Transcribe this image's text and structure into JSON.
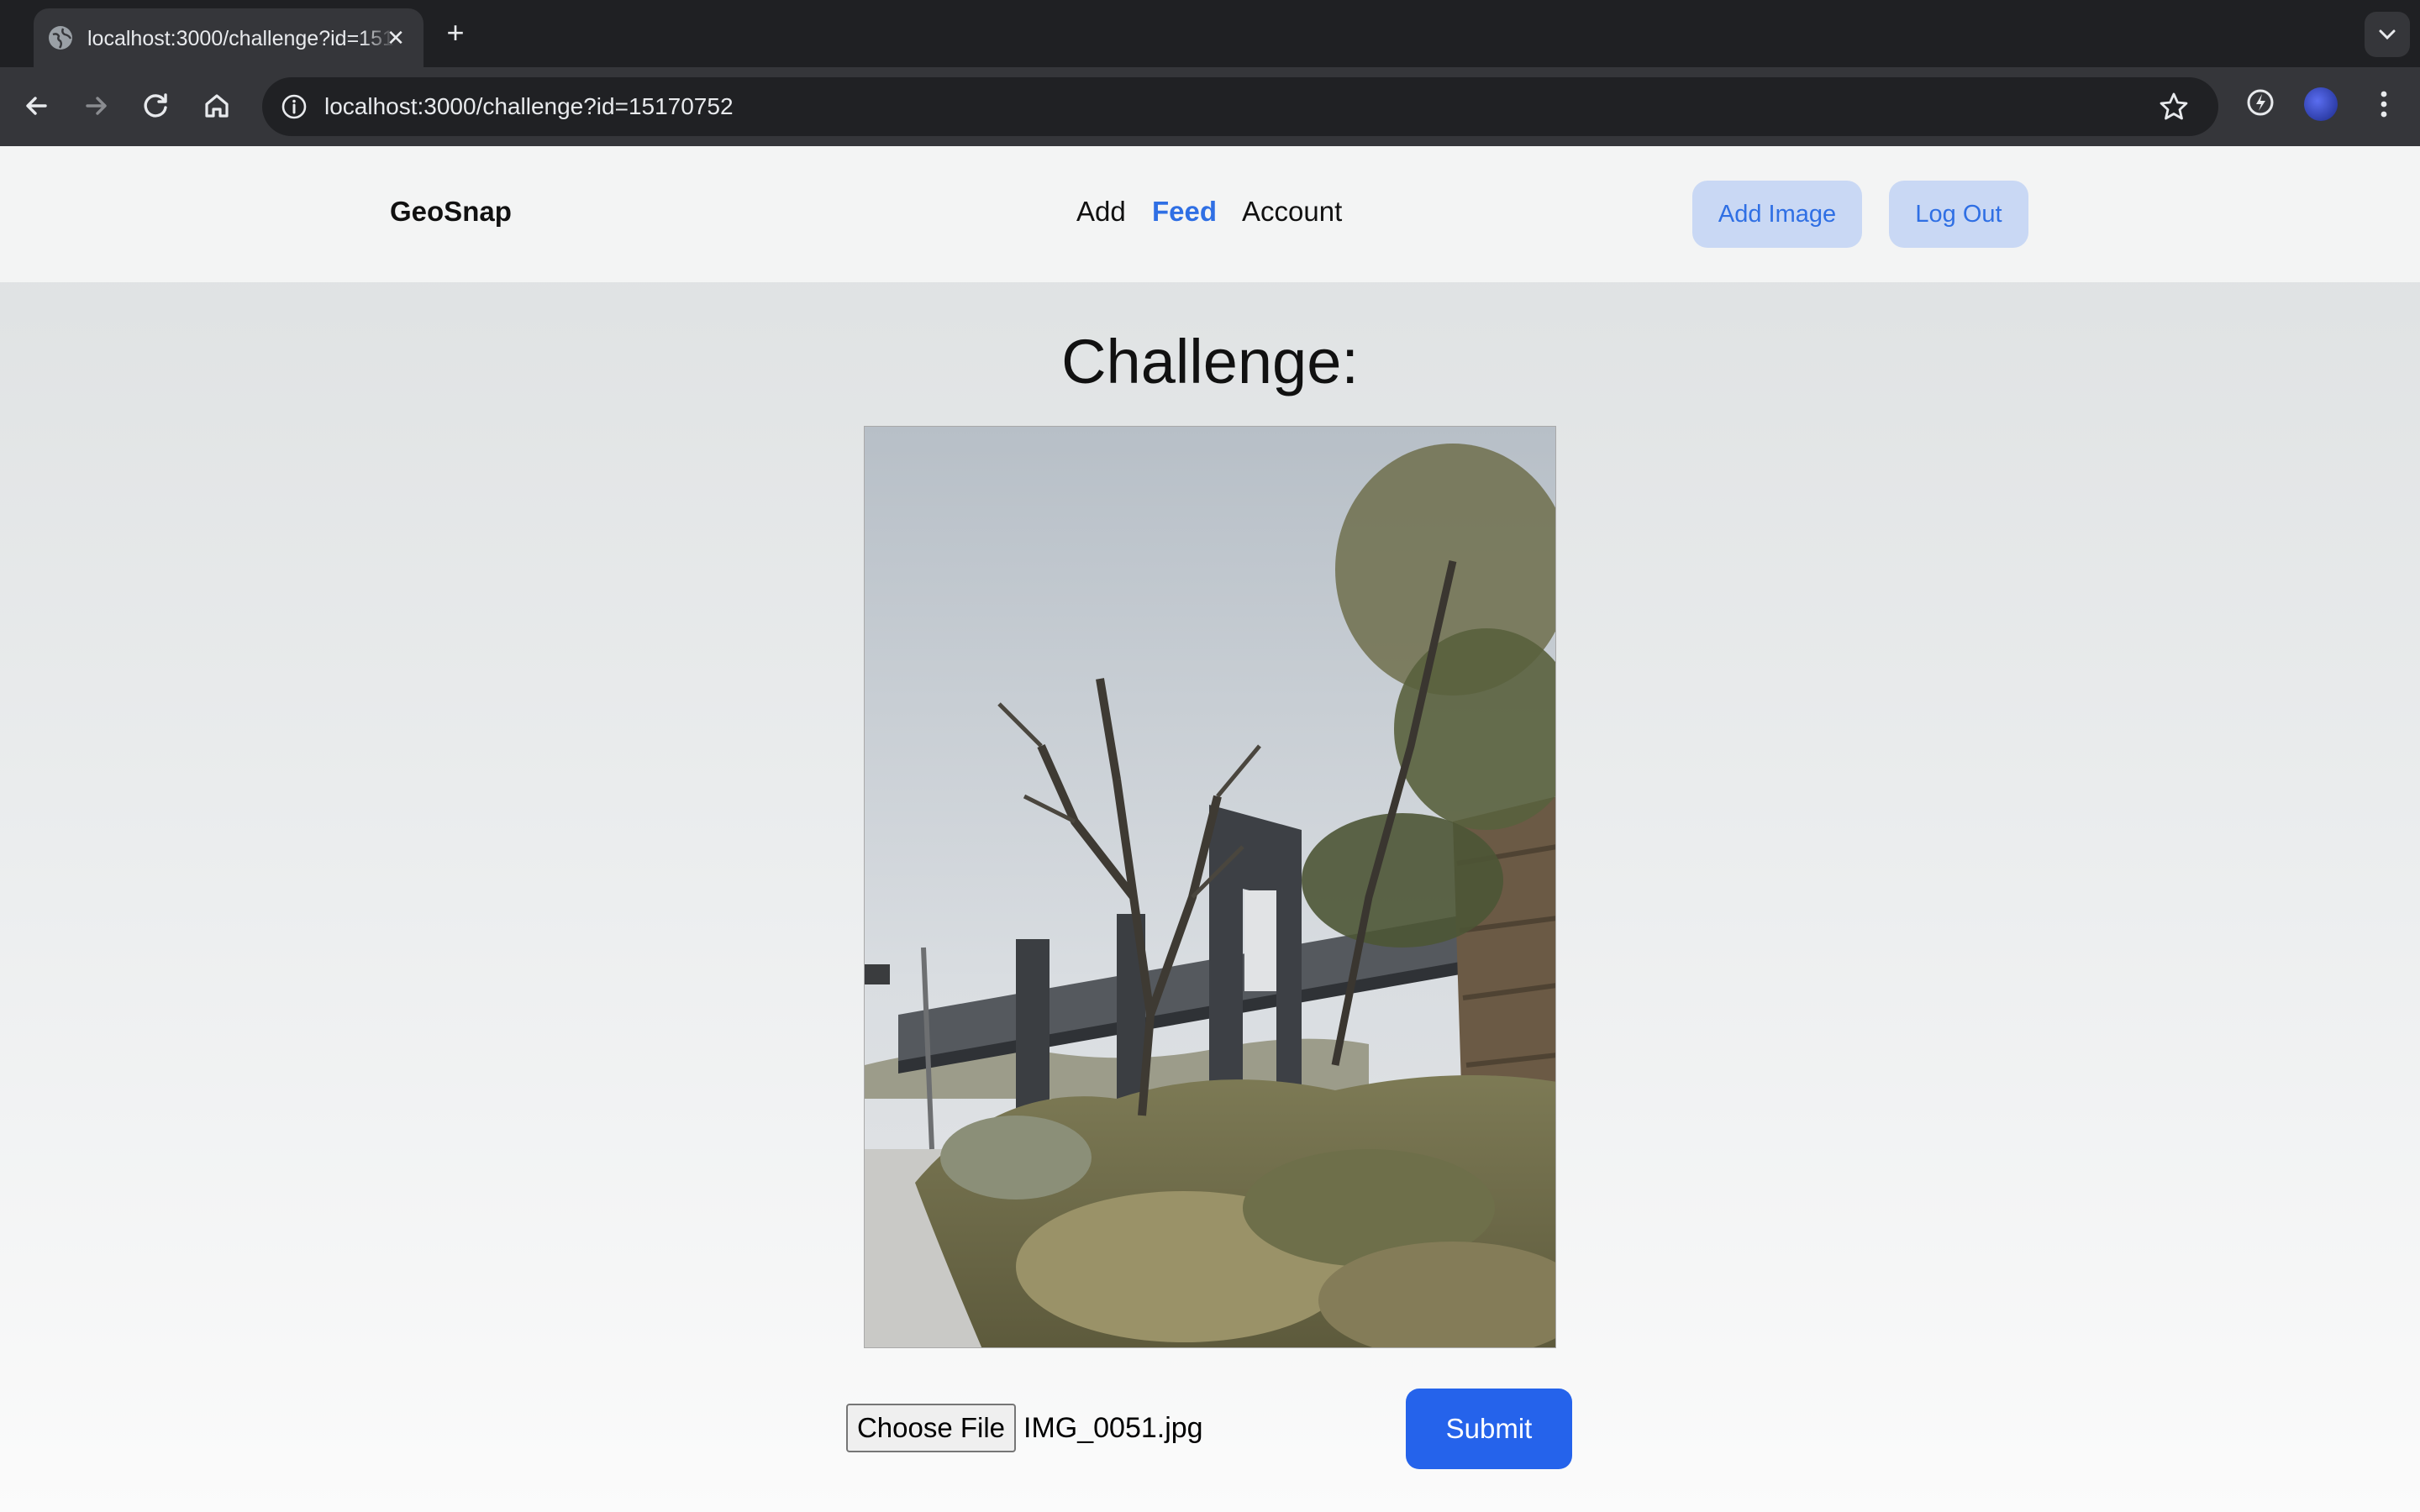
{
  "browser": {
    "tab_title": "localhost:3000/challenge?id=15170752",
    "tab_close": "✕",
    "new_tab": "+",
    "url": "localhost:3000/challenge?id=15170752"
  },
  "nav": {
    "brand": "GeoSnap",
    "links": [
      {
        "label": "Add",
        "active": false
      },
      {
        "label": "Feed",
        "active": true
      },
      {
        "label": "Account",
        "active": false
      }
    ],
    "buttons": {
      "add_image": "Add Image",
      "log_out": "Log Out"
    },
    "accent_color": "#2f6fe4"
  },
  "main": {
    "heading": "Challenge:",
    "upload": {
      "choose_file_label": "Choose File",
      "file_name": "IMG_0051.jpg"
    },
    "submit_label": "Submit",
    "submit_color": "#2563eb"
  }
}
